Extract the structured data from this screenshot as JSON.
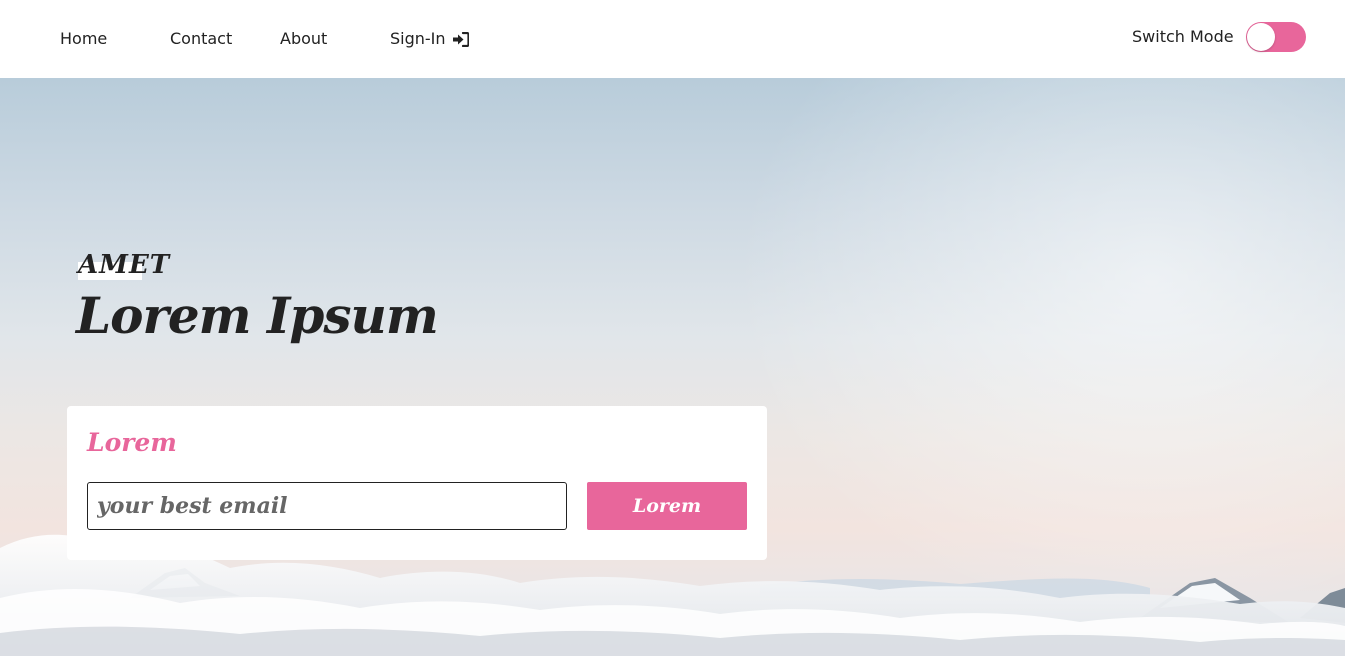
{
  "nav": {
    "home": "Home",
    "contact": "Contact",
    "about": "About",
    "signin": "Sign-In",
    "signin_icon": "sign-in-arrow-icon",
    "switch_label": "Switch Mode"
  },
  "hero": {
    "eyebrow": "AMET",
    "headline": "Lorem Ipsum"
  },
  "form": {
    "title": "Lorem",
    "email_placeholder": "your best email",
    "submit_label": "Lorem"
  },
  "colors": {
    "accent": "#e8669b",
    "text": "#222222",
    "background": "#ffffff"
  }
}
